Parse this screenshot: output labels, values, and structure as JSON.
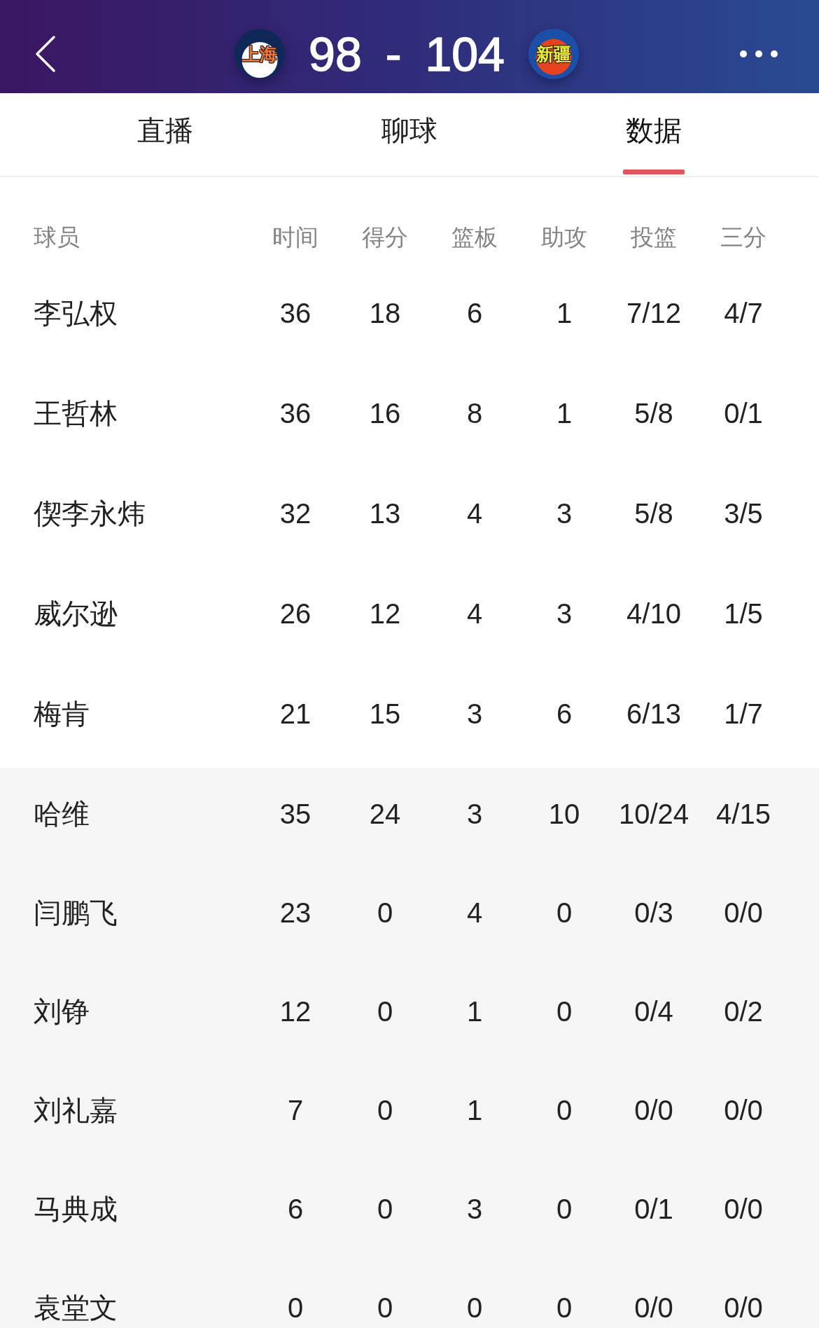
{
  "header": {
    "home_team": {
      "logo_text": "上海",
      "score": "98"
    },
    "separator": "-",
    "away_team": {
      "logo_text": "新疆",
      "score": "104"
    }
  },
  "tabs": [
    {
      "label": "直播",
      "selected": false
    },
    {
      "label": "聊球",
      "selected": false
    },
    {
      "label": "数据",
      "selected": true
    }
  ],
  "table": {
    "columns": [
      "球员",
      "时间",
      "得分",
      "篮板",
      "助攻",
      "投篮",
      "三分"
    ],
    "groups": [
      {
        "kind": "starters",
        "rows": [
          {
            "player": "李弘权",
            "stats": [
              "36",
              "18",
              "6",
              "1",
              "7/12",
              "4/7"
            ]
          },
          {
            "player": "王哲林",
            "stats": [
              "36",
              "16",
              "8",
              "1",
              "5/8",
              "0/1"
            ]
          },
          {
            "player": "偰李永炜",
            "stats": [
              "32",
              "13",
              "4",
              "3",
              "5/8",
              "3/5"
            ]
          },
          {
            "player": "威尔逊",
            "stats": [
              "26",
              "12",
              "4",
              "3",
              "4/10",
              "1/5"
            ]
          },
          {
            "player": "梅肯",
            "stats": [
              "21",
              "15",
              "3",
              "6",
              "6/13",
              "1/7"
            ]
          }
        ]
      },
      {
        "kind": "bench",
        "rows": [
          {
            "player": "哈维",
            "stats": [
              "35",
              "24",
              "3",
              "10",
              "10/24",
              "4/15"
            ]
          },
          {
            "player": "闫鹏飞",
            "stats": [
              "23",
              "0",
              "4",
              "0",
              "0/3",
              "0/0"
            ]
          },
          {
            "player": "刘铮",
            "stats": [
              "12",
              "0",
              "1",
              "0",
              "0/4",
              "0/2"
            ]
          },
          {
            "player": "刘礼嘉",
            "stats": [
              "7",
              "0",
              "1",
              "0",
              "0/0",
              "0/0"
            ]
          },
          {
            "player": "马典成",
            "stats": [
              "6",
              "0",
              "3",
              "0",
              "0/1",
              "0/0"
            ]
          },
          {
            "player": "袁堂文",
            "stats": [
              "0",
              "0",
              "0",
              "0",
              "0/0",
              "0/0"
            ]
          }
        ]
      }
    ]
  }
}
